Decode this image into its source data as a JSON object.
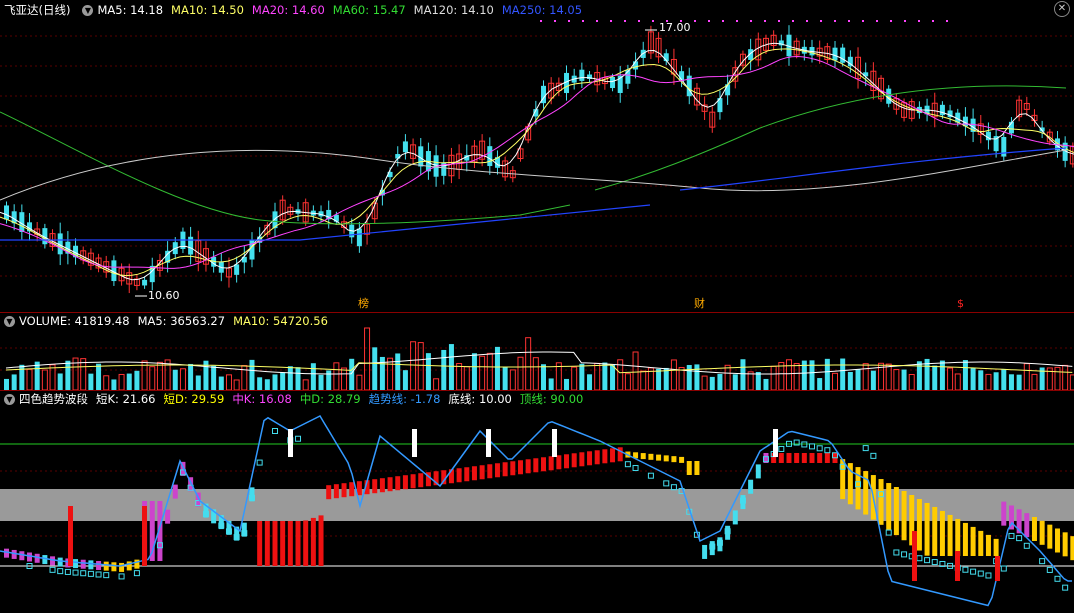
{
  "main": {
    "stock_name": "飞亚达(日线)",
    "indicators": [
      {
        "label": "MA5: 14.18",
        "color": "#ffffff"
      },
      {
        "label": "MA10: 14.50",
        "color": "#ffff66"
      },
      {
        "label": "MA20: 14.60",
        "color": "#ff44ff"
      },
      {
        "label": "MA60: 15.47",
        "color": "#33dd33"
      },
      {
        "label": "MA120: 14.10",
        "color": "#dddddd"
      },
      {
        "label": "MA250: 14.05",
        "color": "#3355ff"
      }
    ],
    "high_label": "17.00",
    "low_label": "10.60",
    "markers": {
      "bang": "榜",
      "cai": "财",
      "dollar": "$"
    },
    "collapse_icon": "chevron-down-icon",
    "close_icon": "close-icon"
  },
  "volume": {
    "title": "VOLUME: 41819.48",
    "ma5": "MA5: 36563.27",
    "ma10": "MA10: 54720.56"
  },
  "wave": {
    "title": "四色趋势波段",
    "items": [
      {
        "label": "短K: 21.66",
        "color": "#ffffff"
      },
      {
        "label": "短D: 29.59",
        "color": "#ffff00"
      },
      {
        "label": "中K: 16.08",
        "color": "#ff44ff"
      },
      {
        "label": "中D: 28.79",
        "color": "#33dd33"
      },
      {
        "label": "趋势线: -1.78",
        "color": "#3399ff"
      },
      {
        "label": "底线: 10.00",
        "color": "#ffffff"
      },
      {
        "label": "顶线: 90.00",
        "color": "#33dd33"
      }
    ]
  },
  "colors": {
    "up": "#ff3333",
    "down": "#44e0ee",
    "red_bar": "#ee1111",
    "magenta": "#cc44cc",
    "yellow": "#ffcc00",
    "cyan": "#44ddee",
    "gray": "#999999"
  }
}
